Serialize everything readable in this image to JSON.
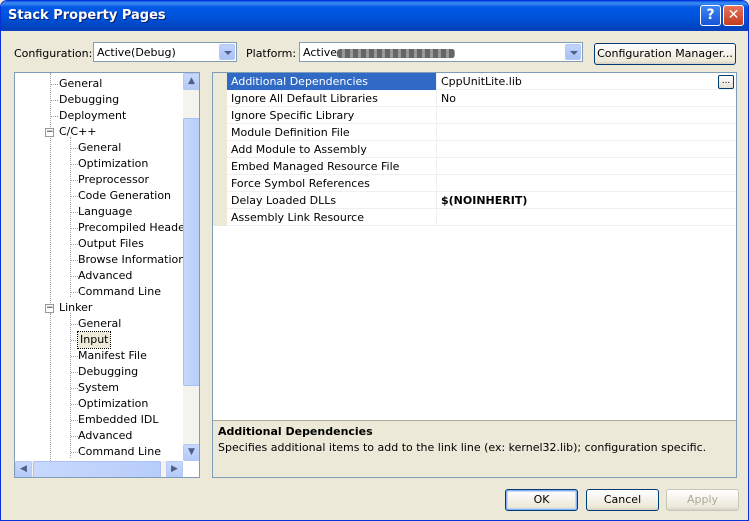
{
  "window": {
    "title": "Stack Property Pages"
  },
  "toolbar": {
    "configuration_label": "Configuration:",
    "configuration_value": "Active(Debug)",
    "platform_label": "Platform:",
    "platform_value": "Active",
    "config_manager_label": "Configuration Manager..."
  },
  "tree": {
    "items": [
      {
        "label": "General",
        "level": 1
      },
      {
        "label": "Debugging",
        "level": 1
      },
      {
        "label": "Deployment",
        "level": 1
      },
      {
        "label": "C/C++",
        "level": 1,
        "expander": "−"
      },
      {
        "label": "General",
        "level": 2
      },
      {
        "label": "Optimization",
        "level": 2
      },
      {
        "label": "Preprocessor",
        "level": 2
      },
      {
        "label": "Code Generation",
        "level": 2
      },
      {
        "label": "Language",
        "level": 2
      },
      {
        "label": "Precompiled Headers",
        "level": 2
      },
      {
        "label": "Output Files",
        "level": 2
      },
      {
        "label": "Browse Information",
        "level": 2
      },
      {
        "label": "Advanced",
        "level": 2
      },
      {
        "label": "Command Line",
        "level": 2
      },
      {
        "label": "Linker",
        "level": 1,
        "expander": "−"
      },
      {
        "label": "General",
        "level": 2
      },
      {
        "label": "Input",
        "level": 2,
        "selected": true
      },
      {
        "label": "Manifest File",
        "level": 2
      },
      {
        "label": "Debugging",
        "level": 2
      },
      {
        "label": "System",
        "level": 2
      },
      {
        "label": "Optimization",
        "level": 2
      },
      {
        "label": "Embedded IDL",
        "level": 2
      },
      {
        "label": "Advanced",
        "level": 2
      },
      {
        "label": "Command Line",
        "level": 2
      }
    ]
  },
  "properties": {
    "rows": [
      {
        "name": "Additional Dependencies",
        "value": "CppUnitLite.lib",
        "selected": true
      },
      {
        "name": "Ignore All Default Libraries",
        "value": "No"
      },
      {
        "name": "Ignore Specific Library",
        "value": ""
      },
      {
        "name": "Module Definition File",
        "value": ""
      },
      {
        "name": "Add Module to Assembly",
        "value": ""
      },
      {
        "name": "Embed Managed Resource File",
        "value": ""
      },
      {
        "name": "Force Symbol References",
        "value": ""
      },
      {
        "name": "Delay Loaded DLLs",
        "value": "$(NOINHERIT)",
        "bold": true
      },
      {
        "name": "Assembly Link Resource",
        "value": ""
      }
    ],
    "ellipsis": "..."
  },
  "description": {
    "title": "Additional Dependencies",
    "text": "Specifies additional items to add to the link line (ex: kernel32.lib); configuration specific."
  },
  "buttons": {
    "ok": "OK",
    "cancel": "Cancel",
    "apply": "Apply"
  },
  "icons": {
    "help": "?",
    "close": "✕",
    "arrow_up": "▲",
    "arrow_down": "▼",
    "arrow_left": "◀",
    "arrow_right": "▶"
  },
  "colors": {
    "selection": "#316ac5",
    "title_bar": "#0052d9",
    "dialog_bg": "#ece9d8"
  }
}
